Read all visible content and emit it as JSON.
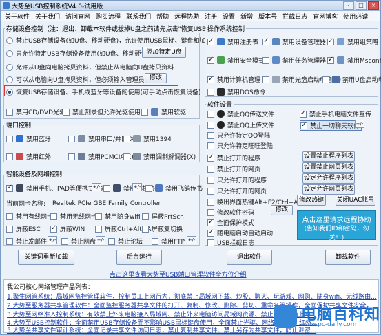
{
  "window": {
    "title": "大势至USB控制系统V4.0-试用版",
    "buttons": [
      "-",
      "□",
      "×"
    ]
  },
  "menu": [
    "关于软件",
    "关于我们",
    "访问官网",
    "购买流程",
    "联系我们",
    "帮助",
    "远程协助",
    "注册",
    "设置",
    "新增",
    "版本号",
    "拦截日志",
    "官网博客",
    "使用必读"
  ],
  "storage": {
    "title": "存储设备控制（注：退出、卸载本软件或拔掉U盘之前请先点击\"恢复USB......\"）",
    "options": [
      {
        "label": "禁止USB存储设备(如U盘、移动硬盘)，允许使用USB鼠标、键盘和加密狗",
        "checked": false
      },
      {
        "label": "只允许特定USB存储设备使用(如U盘、移动硬盘)",
        "checked": false
      },
      {
        "label": "允许从U盘向电脑拷贝资料，但禁止从电脑向U盘拷贝资料",
        "checked": false
      },
      {
        "label": "可以从电脑向U盘拷贝资料，但必须输入管理员密码",
        "checked": false
      },
      {
        "label": "恢复USB存储设备、手机或蓝牙等设备的使用(可手动点击恢复设备)",
        "checked": true
      }
    ],
    "add_udisk_btn": "添加特定U盘",
    "modify_btn": "修改",
    "extra": [
      {
        "label": "禁用CD/DVD光驱",
        "checked": false
      },
      {
        "label": "禁止刻录但允许光驱使用",
        "checked": false
      },
      {
        "label": "禁用软驱",
        "checked": false
      }
    ]
  },
  "ports": {
    "title": "端口控制",
    "items": [
      {
        "label": "禁用蓝牙",
        "checked": false
      },
      {
        "label": "禁用串口/并口(X)",
        "checked": false
      },
      {
        "label": "禁用1394",
        "checked": false
      },
      {
        "label": "禁用红外",
        "checked": false
      },
      {
        "label": "禁用PCMCIA(X)",
        "checked": false
      },
      {
        "label": "禁用调制解调器(X)",
        "checked": false
      }
    ]
  },
  "smart": {
    "title": "智能设备及网络控制",
    "items": [
      {
        "label": "禁用手机、PAD等便携式设备",
        "checked": true
      },
      {
        "label": "禁用手机助手",
        "checked": false
      },
      {
        "label": "禁用飞鸽传书",
        "checked": false
      }
    ],
    "plusminus": "+/-",
    "nic_label": "当前网卡名称:",
    "nic_value": "Realtek PCIe GBE Family Controller",
    "wifi": [
      {
        "label": "禁用有线网卡",
        "checked": false
      },
      {
        "label": "禁用无线网卡",
        "checked": false
      },
      {
        "label": "禁用随身wifi",
        "checked": false
      },
      {
        "label": "屏蔽PrtScn",
        "checked": false
      },
      {
        "label": "屏蔽ESC",
        "checked": false
      },
      {
        "label": "屏蔽WIN",
        "checked": true
      },
      {
        "label": "屏蔽Ctrl+Alt+A",
        "checked": false
      },
      {
        "label": "屏蔽复切换",
        "checked": false
      },
      {
        "label": "禁止发邮件",
        "checked": false
      },
      {
        "label": "禁止网盘",
        "checked": false
      },
      {
        "label": "禁止论坛",
        "checked": false
      },
      {
        "label": "禁用FTP",
        "checked": false
      }
    ]
  },
  "os_control": {
    "title": "操作系统控制",
    "items": [
      {
        "label": "禁用注册表",
        "checked": true
      },
      {
        "label": "禁用设备管理器",
        "checked": true
      },
      {
        "label": "禁用组策略",
        "checked": true
      },
      {
        "label": "禁用安全模式",
        "checked": true
      },
      {
        "label": "禁用任务管理器",
        "checked": false
      },
      {
        "label": "禁用Msconfig",
        "checked": true
      },
      {
        "label": "禁用计算机管理",
        "checked": true
      },
      {
        "label": "禁用光盘启动电脑(X)",
        "checked": false
      },
      {
        "label": "禁用U盘启动电脑(X)",
        "checked": false
      },
      {
        "label": "禁用DOS命令",
        "checked": false
      }
    ]
  },
  "software": {
    "title": "软件设置",
    "rows": [
      {
        "label": "禁止QQ传送文件",
        "checked": false
      },
      {
        "label": "禁止QQ上传文件",
        "checked": false
      },
      {
        "label": "只允许特定QQ登陆",
        "checked": false
      },
      {
        "label": "只允许特定旺旺登陆",
        "checked": false
      },
      {
        "label": "禁止打开的程序",
        "checked": true
      },
      {
        "label": "禁止打开的网页",
        "checked": false
      },
      {
        "label": "只允许打开的程序",
        "checked": false
      },
      {
        "label": "只允许打开的网页",
        "checked": false
      },
      {
        "label": "唤出界面热键Alt+F2/Ctrl+Alt+Z",
        "checked": false
      },
      {
        "label": "修改软件密码",
        "checked": false
      },
      {
        "label": "全面保护模式",
        "checked": true
      },
      {
        "label": "随电脑启动自动启动",
        "checked": true
      },
      {
        "label": "USB拦截日志",
        "checked": false
      }
    ],
    "right": [
      {
        "label": "禁止手机电脑文件互传",
        "checked": true
      },
      {
        "label": "禁止一切聊天软件",
        "checked": true
      }
    ],
    "buttons": [
      "设置禁止程序列表",
      "设置禁止网页列表",
      "设定允许程序列表",
      "设定允许网页列表"
    ],
    "hotkey_btn": "修改热键",
    "uac_btn": "关闭UAC账号",
    "modify_btn": "修改",
    "remote_btn_l1": "点击这里请求远程协助",
    "remote_btn_l2": "(告知我们ID和密码，勿关！)"
  },
  "bottom_buttons": [
    "关键词重新加载",
    "后台运行",
    "退出软件",
    "卸载软件"
  ],
  "download_link": "点击这里查看大势至USB端口管理软件全方位介绍",
  "products": {
    "title": "我公司核心网络管理产品列表：",
    "lines": [
      "1.聚生网管系统：局域网监控管理软件，控制员工上网行为，彻底禁止局域网下载、炒股、聊天、玩游戏、网购、随身wifi、无线路由...",
      "2.大势至服务器共享管理软件：全面监控服务器共享文件的打开、复制、修改、删除、剪切、重命名等操作，全面保护共享文件安全...",
      "3.大势至网络准入控制系统：有效禁止外来电脑接入局域网、禁止外来电脑访问局域网资源、禁止外来电脑上网...",
      "4.大势至USB控制软件：全面禁用USB存储设备而不影响USB鼠标键盘使用，全面禁止光驱、网络、蓝牙、红外...",
      "5.大势至共享文件审计系统：全面记录共享文件访问日志，禁止复制共享文件、禁止另存为共享文件，防止泄密..."
    ]
  },
  "watermark": {
    "brand": "电脑百科知识",
    "url": "www.pc-daily.com"
  }
}
